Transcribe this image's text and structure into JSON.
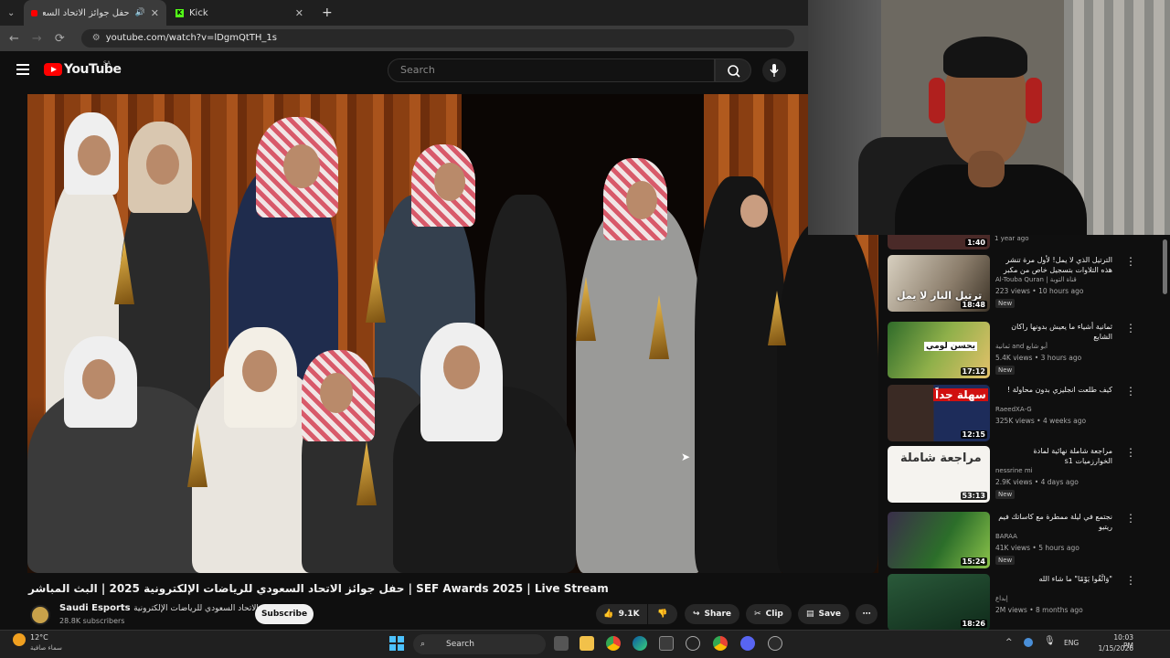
{
  "browser": {
    "tabs": [
      {
        "label": "حفل جوائز الاتحاد السعودي لل",
        "active": true,
        "icon": "youtube-favicon"
      },
      {
        "label": "Kick",
        "active": false,
        "icon": "kick-favicon"
      }
    ],
    "url": "youtube.com/watch?v=lDgmQtTH_1s"
  },
  "youtube": {
    "logo_text": "YouTube",
    "region": "SA",
    "search_placeholder": "Search"
  },
  "video": {
    "title": "حفل جوائز الاتحاد السعودي للرياضات الإلكترونية 2025 | البث المباشر | SEF Awards 2025 | Live Stream",
    "channel": "Saudi Esports",
    "channel_ar": "الاتحاد السعودي للرياضات الإلكترونية",
    "subscribers": "28.8K subscribers",
    "subscribe_label": "Subscribe",
    "likes": "9.1K",
    "share_label": "Share",
    "clip_label": "Clip",
    "save_label": "Save"
  },
  "sidebar": {
    "partial_top": {
      "duration": "1:40",
      "meta": "1 year ago"
    },
    "items": [
      {
        "title": "الترتيل الذي لا يمل! لأول مرة تنشر هذه التلاوات بتسجيل خاص من مكبر الحرم ...",
        "channel": "Al-Touba Quran | قناة التوبة",
        "views": "223 views • 10 hours ago",
        "badge": "New",
        "duration": "18:48",
        "thumb_text": "ترتيل النار لا يمل"
      },
      {
        "title": "ثمانية أشياء ما يعيش بدونها راكان الشايع",
        "channel": "ثمانية and أبو شايع",
        "views": "5.4K views • 3 hours ago",
        "badge": "New",
        "duration": "17:12",
        "thumb_text": "يحسن لومي"
      },
      {
        "title": "كيف طلعت انجليزي بدون محاولة !",
        "channel": "RaeedXA-G",
        "views": "325K views • 4 weeks ago",
        "badge": "",
        "duration": "12:15",
        "thumb_text": "سهلة جداً"
      },
      {
        "title": "مراجعة شاملة نهائية لمادة الخوارزميات s1",
        "channel": "nessrine mi",
        "views": "2.9K views • 4 days ago",
        "badge": "New",
        "duration": "53:13",
        "thumb_text": "مراجعة شاملة"
      },
      {
        "title": "نجتمع في ليلة ممطرة مع كاساتك فيم ريتيو",
        "channel": "BARAA",
        "views": "41K views • 5 hours ago",
        "badge": "New",
        "duration": "15:24",
        "thumb_text": ""
      },
      {
        "title": "\"وَاتَّقُوا يَوْمًا\" ما شاء الله",
        "channel": "إبداع",
        "views": "2M views • 8 months ago",
        "badge": "",
        "duration": "18:26",
        "thumb_text": ""
      }
    ]
  },
  "taskbar": {
    "weather_temp": "12°C",
    "weather_desc": "سماء صافية",
    "search_label": "Search",
    "language": "ENG",
    "time": "10:03 PM",
    "date": "1/15/2026"
  },
  "colors": {
    "youtube_red": "#ff0000",
    "background": "#0f0f0f",
    "chrome_tab": "#3b3b3b"
  }
}
